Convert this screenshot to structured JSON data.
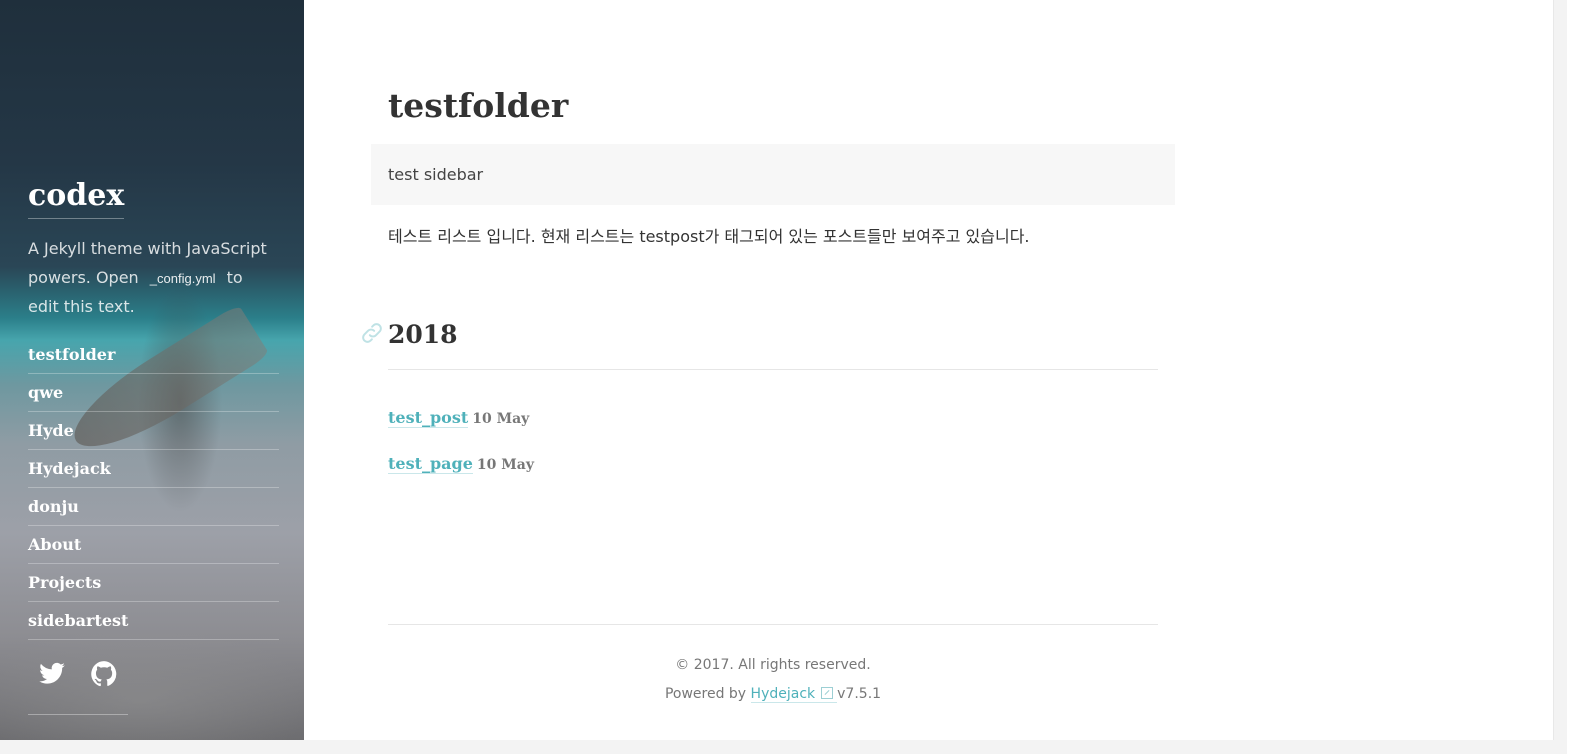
{
  "sidebar": {
    "title": "codex",
    "description_before": "A Jekyll theme with JavaScript powers. Open",
    "description_code": "_config.yml",
    "description_after": "to edit this text.",
    "nav": [
      {
        "label": "testfolder"
      },
      {
        "label": "qwe"
      },
      {
        "label": "Hyde"
      },
      {
        "label": "Hydejack"
      },
      {
        "label": "donju"
      },
      {
        "label": "About"
      },
      {
        "label": "Projects"
      },
      {
        "label": "sidebartest"
      }
    ],
    "social": [
      "twitter-icon",
      "github-icon"
    ]
  },
  "main": {
    "title": "testfolder",
    "callout": "test sidebar",
    "intro": "테스트 리스트 입니다. 현재 리스트는 testpost가 태그되어 있는 포스트들만 보여주고 있습니다.",
    "year": "2018",
    "posts": [
      {
        "title": "test_post",
        "date": "10 May"
      },
      {
        "title": "test_page",
        "date": "10 May"
      }
    ]
  },
  "footer": {
    "copyright": "© 2017. All rights reserved.",
    "powered_prefix": "Powered by",
    "powered_link": "Hydejack",
    "version": "v7.5.1"
  },
  "colors": {
    "accent": "#4fb1ba",
    "text": "#333333",
    "callout_bg": "#f7f7f7"
  }
}
